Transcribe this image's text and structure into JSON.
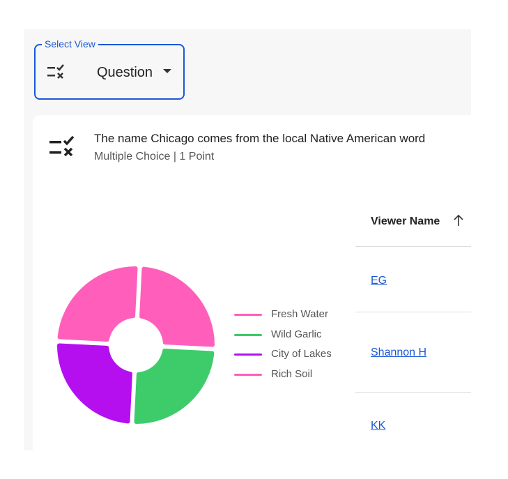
{
  "select_view": {
    "label": "Select View",
    "value": "Question",
    "icon": "question-list-icon"
  },
  "question": {
    "title": "The name Chicago comes from the local Native American word",
    "subtitle": "Multiple Choice | 1 Point",
    "icon": "question-list-icon"
  },
  "chart_data": {
    "type": "pie",
    "title": "",
    "series": [
      {
        "name": "Fresh Water",
        "value": 1,
        "color": "#ff5fbb"
      },
      {
        "name": "Wild Garlic",
        "value": 1,
        "color": "#3ecb6a"
      },
      {
        "name": "City of Lakes",
        "value": 1,
        "color": "#b50ff0"
      },
      {
        "name": "Rich Soil",
        "value": 1,
        "color": "#ff5fbb"
      }
    ],
    "legend_position": "right"
  },
  "table": {
    "header": "Viewer Name",
    "sort_icon": "arrow-up-icon",
    "rows": [
      "EG",
      "Shannon H",
      "KK"
    ]
  }
}
